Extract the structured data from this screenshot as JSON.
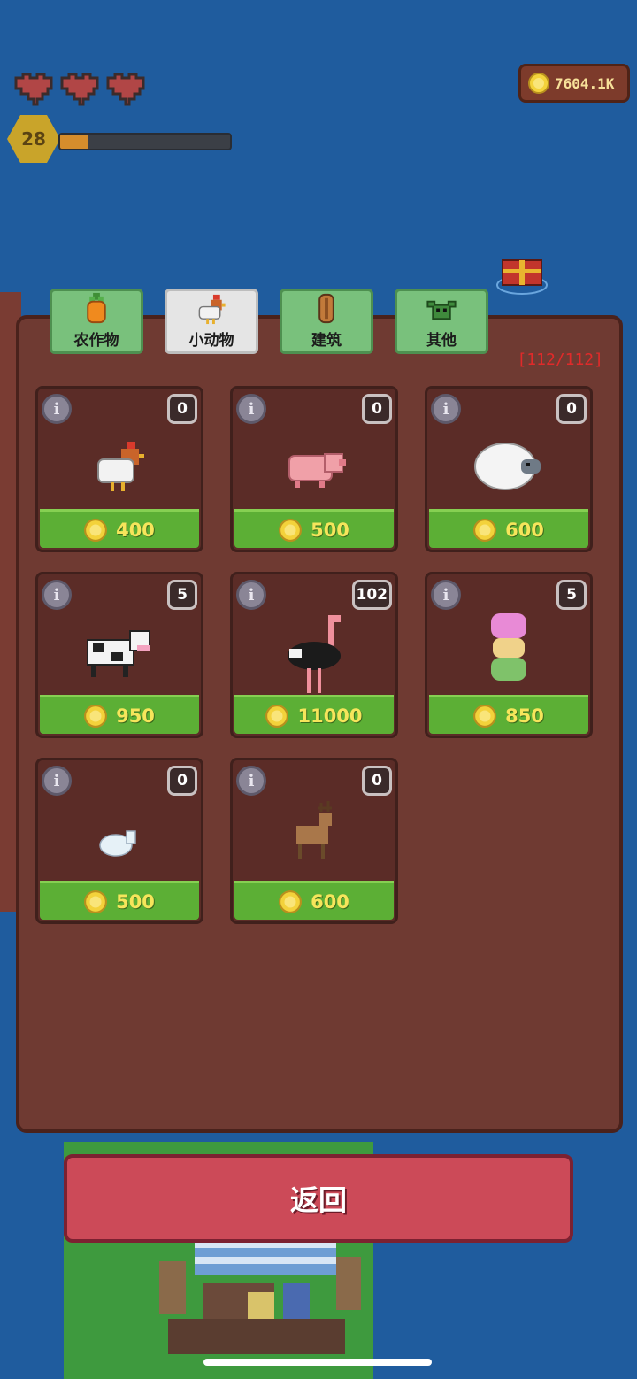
{
  "hud": {
    "hearts": 3,
    "level": "28",
    "xp_progress": 0.16,
    "coins": "7604.1K"
  },
  "tabs": [
    {
      "label": "农作物",
      "icon": "carrot-icon",
      "active": false
    },
    {
      "label": "小动物",
      "icon": "chicken-icon",
      "active": true
    },
    {
      "label": "建筑",
      "icon": "wood-log-icon",
      "active": false
    },
    {
      "label": "其他",
      "icon": "goblin-icon",
      "active": false
    }
  ],
  "capacity": "[112/112]",
  "animals": [
    {
      "name": "chicken",
      "count": "0",
      "price": "400"
    },
    {
      "name": "pig",
      "count": "0",
      "price": "500"
    },
    {
      "name": "sheep",
      "count": "0",
      "price": "600"
    },
    {
      "name": "cow",
      "count": "5",
      "price": "950"
    },
    {
      "name": "ostrich",
      "count": "102",
      "price": "11000"
    },
    {
      "name": "slime-stack",
      "count": "5",
      "price": "850"
    },
    {
      "name": "rabbit",
      "count": "0",
      "price": "500"
    },
    {
      "name": "deer",
      "count": "0",
      "price": "600"
    }
  ],
  "back_label": "返回",
  "colors": {
    "water": "#1f5c9e",
    "panel": "#6f3a32",
    "card": "#5b2c27",
    "price_button": "#5caf35",
    "price_text": "#f6e55b",
    "capacity_text": "#e02a2a",
    "back_button": "#cc4a58"
  }
}
